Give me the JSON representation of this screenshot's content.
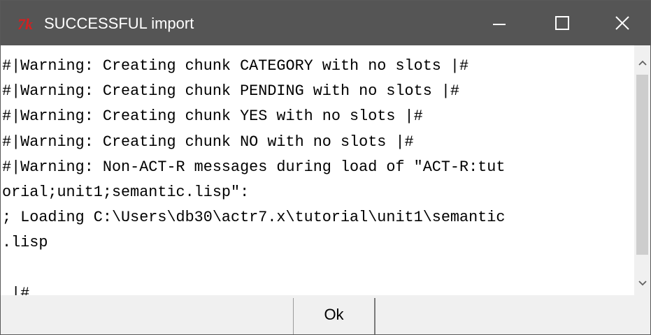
{
  "window": {
    "title": "SUCCESSFUL import",
    "icon": "tk-feather-icon",
    "colors": {
      "titlebar": "#555555",
      "title_text": "#ffffff",
      "icon_red": "#d42020"
    }
  },
  "output": {
    "text": "#|Warning: Creating chunk CATEGORY with no slots |#\n#|Warning: Creating chunk PENDING with no slots |#\n#|Warning: Creating chunk YES with no slots |#\n#|Warning: Creating chunk NO with no slots |#\n#|Warning: Non-ACT-R messages during load of \"ACT-R:tut\norial;unit1;semantic.lisp\":\n; Loading C:\\Users\\db30\\actr7.x\\tutorial\\unit1\\semantic\n.lisp\n\n |#"
  },
  "footer": {
    "ok_label": "Ok"
  }
}
